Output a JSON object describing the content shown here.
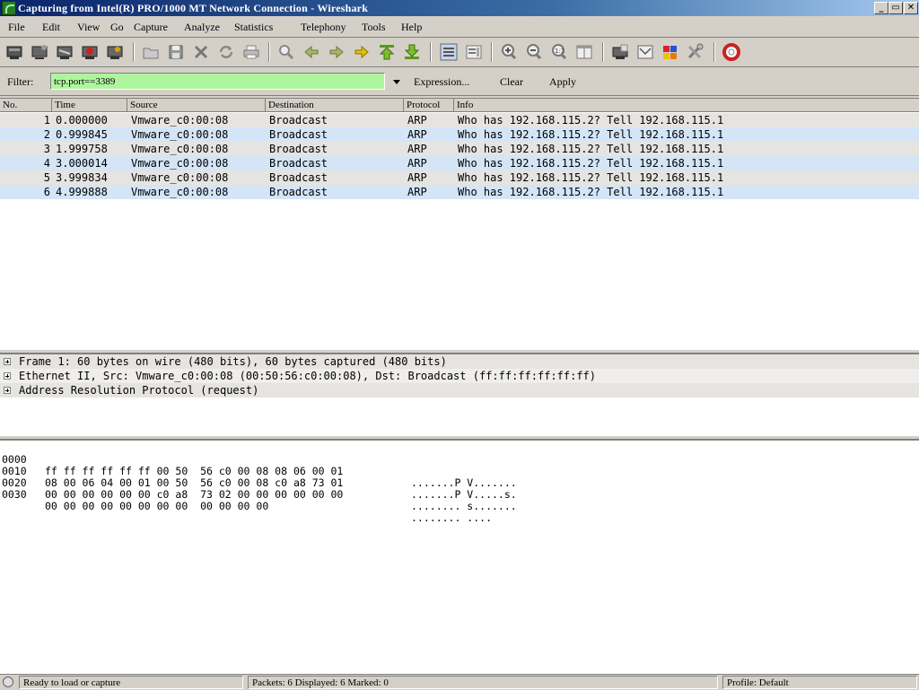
{
  "window": {
    "title": "Capturing from Intel(R) PRO/1000 MT Network Connection - Wireshark",
    "minimize": "_",
    "maximize": "▭",
    "close": "✕"
  },
  "menu": [
    "File",
    "Edit",
    "View",
    "Go",
    "Capture",
    "Analyze",
    "Statistics",
    "Telephony",
    "Tools",
    "Help"
  ],
  "toolbar": {
    "icons": [
      "interfaces-icon",
      "capture-options-icon",
      "start-capture-icon",
      "stop-capture-icon",
      "restart-capture-icon",
      "open-file-icon",
      "save-file-icon",
      "close-file-icon",
      "reload-icon",
      "print-icon",
      "find-icon",
      "go-back-icon",
      "go-forward-icon",
      "go-to-packet-icon",
      "go-first-icon",
      "go-last-icon",
      "colorize-icon",
      "auto-scroll-icon",
      "zoom-in-icon",
      "zoom-out-icon",
      "zoom-normal-icon",
      "resize-columns-icon",
      "capture-filters-icon",
      "display-filters-icon",
      "coloring-rules-icon",
      "preferences-icon",
      "help-icon"
    ]
  },
  "filter": {
    "label": "Filter:",
    "value": "tcp.port==3389",
    "expression": "Expression...",
    "clear": "Clear",
    "apply": "Apply"
  },
  "packet_list": {
    "columns": [
      "No.",
      "Time",
      "Source",
      "Destination",
      "Protocol",
      "Info"
    ],
    "rows": [
      {
        "no": "1",
        "time": "0.000000",
        "src": "Vmware_c0:00:08",
        "dst": "Broadcast",
        "proto": "ARP",
        "info": "Who has 192.168.115.2?  Tell 192.168.115.1"
      },
      {
        "no": "2",
        "time": "0.999845",
        "src": "Vmware_c0:00:08",
        "dst": "Broadcast",
        "proto": "ARP",
        "info": "Who has 192.168.115.2?  Tell 192.168.115.1"
      },
      {
        "no": "3",
        "time": "1.999758",
        "src": "Vmware_c0:00:08",
        "dst": "Broadcast",
        "proto": "ARP",
        "info": "Who has 192.168.115.2?  Tell 192.168.115.1"
      },
      {
        "no": "4",
        "time": "3.000014",
        "src": "Vmware_c0:00:08",
        "dst": "Broadcast",
        "proto": "ARP",
        "info": "Who has 192.168.115.2?  Tell 192.168.115.1"
      },
      {
        "no": "5",
        "time": "3.999834",
        "src": "Vmware_c0:00:08",
        "dst": "Broadcast",
        "proto": "ARP",
        "info": "Who has 192.168.115.2?  Tell 192.168.115.1"
      },
      {
        "no": "6",
        "time": "4.999888",
        "src": "Vmware_c0:00:08",
        "dst": "Broadcast",
        "proto": "ARP",
        "info": "Who has 192.168.115.2?  Tell 192.168.115.1"
      }
    ]
  },
  "details": [
    "Frame 1: 60 bytes on wire (480 bits), 60 bytes captured (480 bits)",
    "Ethernet II, Src: Vmware_c0:00:08 (00:50:56:c0:00:08), Dst: Broadcast (ff:ff:ff:ff:ff:ff)",
    "Address Resolution Protocol (request)"
  ],
  "hex": [
    {
      "offset": "0000",
      "bytes": "ff ff ff ff ff ff 00 50  56 c0 00 08 08 06 00 01",
      "ascii": ".......P V......."
    },
    {
      "offset": "0010",
      "bytes": "08 00 06 04 00 01 00 50  56 c0 00 08 c0 a8 73 01",
      "ascii": ".......P V.....s."
    },
    {
      "offset": "0020",
      "bytes": "00 00 00 00 00 00 c0 a8  73 02 00 00 00 00 00 00",
      "ascii": "........ s......."
    },
    {
      "offset": "0030",
      "bytes": "00 00 00 00 00 00 00 00  00 00 00 00",
      "ascii": "........ ...."
    }
  ],
  "status": {
    "ready": "Ready to load or capture",
    "packets": "Packets: 6 Displayed: 6 Marked: 0",
    "profile": "Profile: Default"
  }
}
